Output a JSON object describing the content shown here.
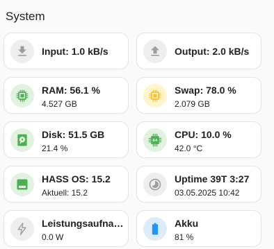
{
  "section_title": "System",
  "cards": {
    "input": {
      "primary": "Input: 1.0 kB/s",
      "icon": "download-icon",
      "color": "#9e9e9e",
      "bg": "#eeeeee"
    },
    "output": {
      "primary": "Output: 2.0 kB/s",
      "icon": "upload-icon",
      "color": "#9e9e9e",
      "bg": "#eeeeee"
    },
    "ram": {
      "primary": "RAM: 56.1 %",
      "secondary": "4.527 GB",
      "icon": "memory-chip-icon",
      "color": "#4caf50",
      "bg": "#e1f2e1"
    },
    "swap": {
      "primary": "Swap: 78.0 %",
      "secondary": "2.079 GB",
      "icon": "memory-chip-icon",
      "color": "#fbc02d",
      "bg": "#fff4cc"
    },
    "disk": {
      "primary": "Disk: 51.5 GB",
      "secondary": "21.4 %",
      "icon": "harddisk-icon",
      "color": "#4caf50",
      "bg": "#e1f2e1"
    },
    "cpu": {
      "primary": "CPU: 10.0 %",
      "secondary": "42.0 °C",
      "icon": "cpu-64-icon",
      "color": "#4caf50",
      "bg": "#e1f2e1"
    },
    "hassos": {
      "primary": "HASS OS: 15.2",
      "secondary": "Aktuell: 15.2",
      "icon": "package-icon",
      "color": "#4caf50",
      "bg": "#e1f2e1"
    },
    "uptime": {
      "primary": "Uptime 39T 3:27",
      "secondary": "03.05.2025 10:42",
      "icon": "clock-icon",
      "color": "#9e9e9e",
      "bg": "#eeeeee"
    },
    "power": {
      "primary": "Leistungsaufnahme",
      "secondary": "0.0 W",
      "icon": "lightning-icon",
      "color": "#9e9e9e",
      "bg": "#eeeeee"
    },
    "battery": {
      "primary": "Akku",
      "secondary": "81 %",
      "icon": "battery-icon",
      "color": "#2196f3",
      "bg": "#dcecfb"
    }
  }
}
